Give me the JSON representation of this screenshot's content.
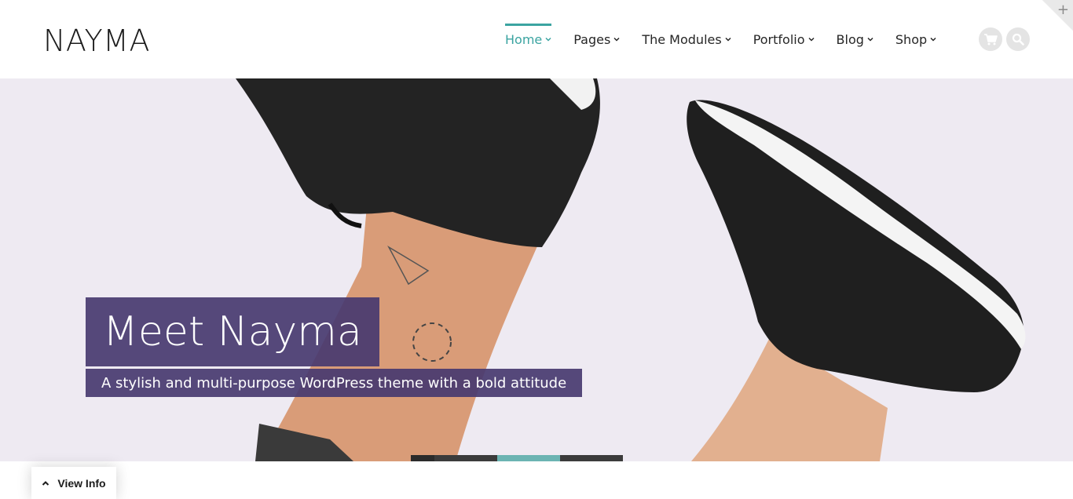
{
  "site": {
    "logo": "NAYMA"
  },
  "nav": {
    "items": [
      {
        "label": "Home",
        "active": true
      },
      {
        "label": "Pages",
        "active": false
      },
      {
        "label": "The Modules",
        "active": false
      },
      {
        "label": "Portfolio",
        "active": false
      },
      {
        "label": "Blog",
        "active": false
      },
      {
        "label": "Shop",
        "active": false
      }
    ],
    "accent_color": "#3ba4a1",
    "icons": [
      "cart-icon",
      "search-icon"
    ]
  },
  "hero": {
    "title": "Meet Nayma",
    "subtitle": "A stylish and multi-purpose WordPress theme with a bold attitude",
    "overlay_color": "#483a70",
    "slides": {
      "count": 4,
      "active_index": 2
    }
  },
  "view_info": {
    "label": "View Info"
  },
  "corner": {
    "icon": "plus-icon",
    "glyph": "+"
  }
}
